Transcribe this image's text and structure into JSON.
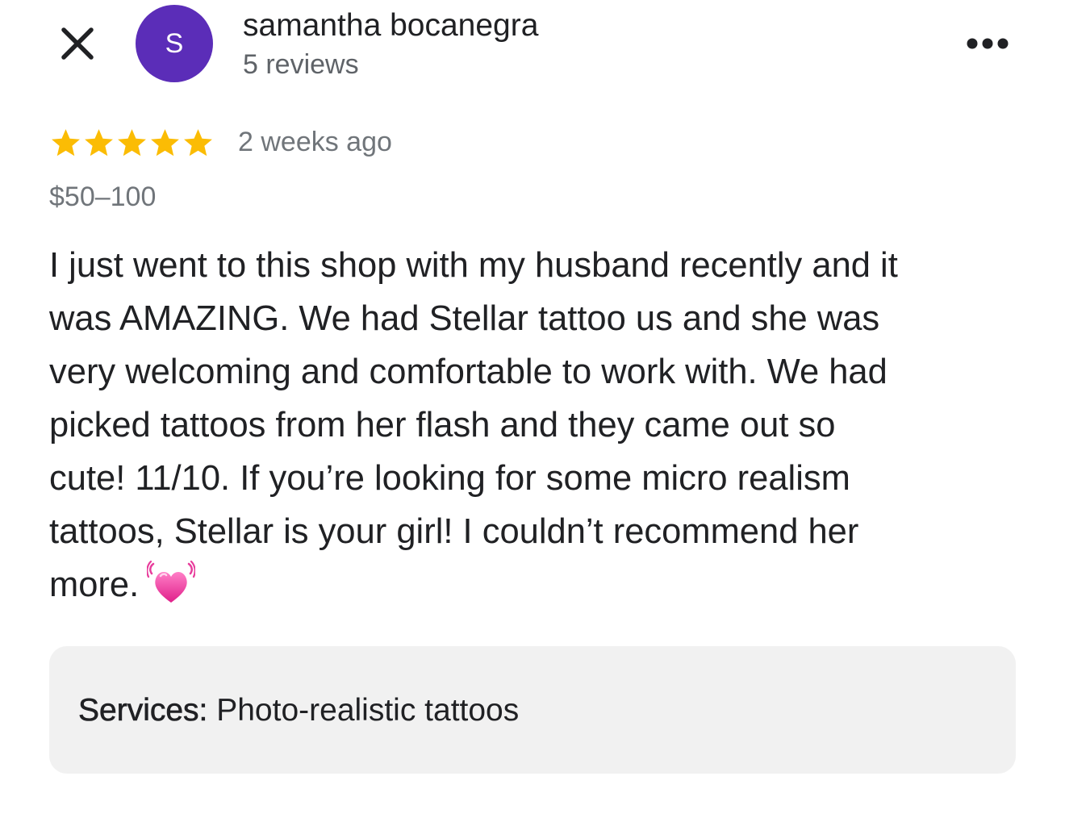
{
  "header": {
    "close_icon": "close-icon",
    "more_icon": "more-horizontal-icon"
  },
  "author": {
    "avatar_initial": "S",
    "avatar_color": "#5b2db8",
    "name": "samantha bocanegra",
    "review_count": "5 reviews"
  },
  "review": {
    "rating": 5,
    "max_rating": 5,
    "star_color": "#fbbc04",
    "time_ago": "2 weeks ago",
    "price_range": "$50–100",
    "text_lines": [
      "I just went to this shop with my husband recently and it",
      "was AMAZING. We had Stellar tattoo us and she was",
      "very welcoming and comfortable to work with. We had",
      "picked tattoos from her flash and they came out so",
      "cute! 11/10. If you’re looking for some micro realism",
      "tattoos, Stellar is your girl! I couldn’t recommend her",
      "more."
    ],
    "emoji": "beating-heart-emoji"
  },
  "services": {
    "label": "Services:",
    "value": "Photo-realistic tattoos"
  }
}
